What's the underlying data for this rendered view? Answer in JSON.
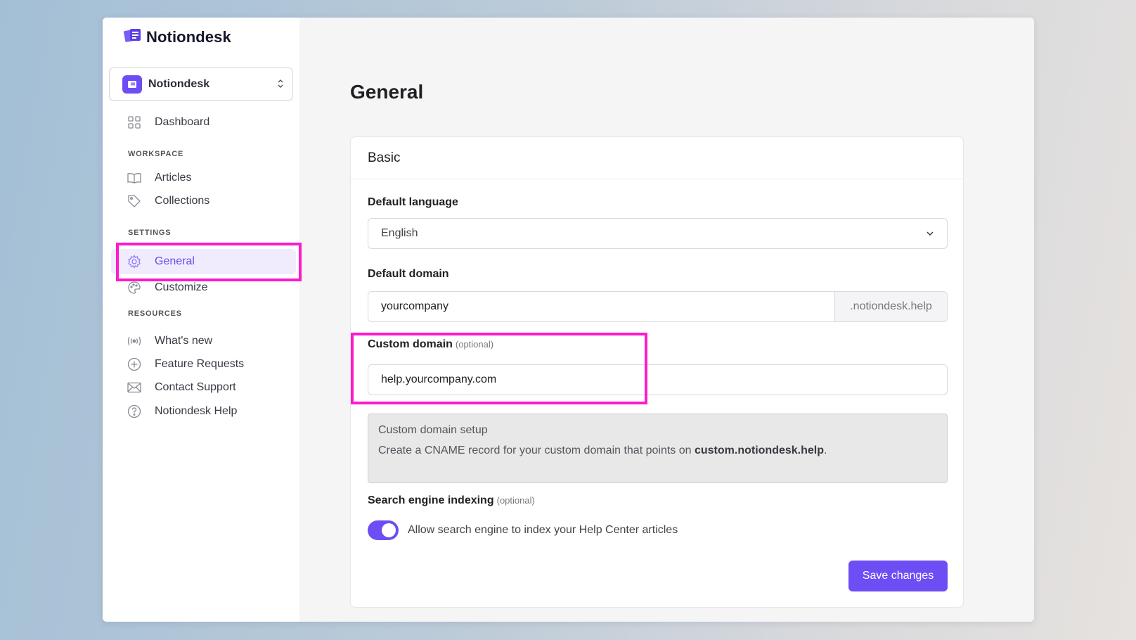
{
  "brand": {
    "name": "Notiondesk",
    "accent": "#6d4ef5",
    "highlight": "#ff1acb"
  },
  "workspace_selector": {
    "name": "Notiondesk",
    "icon": "chevron-up-down-icon"
  },
  "sidebar": {
    "dashboard": {
      "label": "Dashboard",
      "icon": "grid-icon"
    },
    "workspace_label": "WORKSPACE",
    "workspace_items": [
      {
        "label": "Articles",
        "icon": "book-icon"
      },
      {
        "label": "Collections",
        "icon": "tag-icon"
      }
    ],
    "settings_label": "SETTINGS",
    "settings_items": [
      {
        "label": "General",
        "icon": "gear-icon",
        "active": true
      },
      {
        "label": "Customize",
        "icon": "palette-icon"
      }
    ],
    "resources_label": "RESOURCES",
    "resources_items": [
      {
        "label": "What's new",
        "icon": "broadcast-icon"
      },
      {
        "label": "Feature Requests",
        "icon": "plus-circle-icon"
      },
      {
        "label": "Contact Support",
        "icon": "mail-icon"
      },
      {
        "label": "Notiondesk Help",
        "icon": "help-circle-icon"
      }
    ]
  },
  "main": {
    "title": "General",
    "card": {
      "title": "Basic",
      "default_language": {
        "label": "Default language",
        "value": "English"
      },
      "default_domain": {
        "label": "Default domain",
        "value": "yourcompany",
        "suffix": ".notiondesk.help"
      },
      "custom_domain": {
        "label": "Custom domain",
        "optional": "(optional)",
        "value": "help.yourcompany.com"
      },
      "setup": {
        "title": "Custom domain setup",
        "text_prefix": "Create a CNAME record for your custom domain that points on ",
        "text_bold": "custom.notiondesk.help",
        "text_suffix": "."
      },
      "indexing": {
        "label": "Search engine indexing",
        "optional": "(optional)",
        "toggle_label": "Allow search engine to index your Help Center articles",
        "enabled": true
      },
      "save_label": "Save changes"
    }
  }
}
